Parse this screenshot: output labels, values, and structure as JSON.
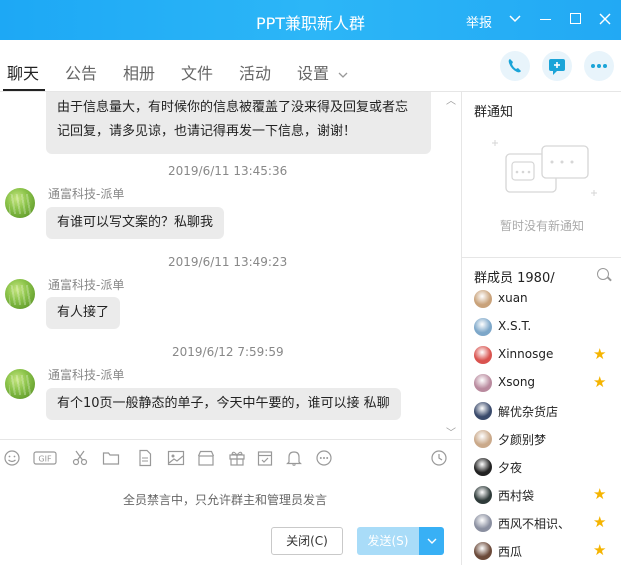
{
  "window": {
    "title": "PPT兼职新人群",
    "report_label": "举报"
  },
  "tabs": [
    {
      "label": "聊天",
      "active": true
    },
    {
      "label": "公告"
    },
    {
      "label": "相册"
    },
    {
      "label": "文件"
    },
    {
      "label": "活动"
    },
    {
      "label": "设置"
    }
  ],
  "header_actions": [
    "phone-icon",
    "chat-add-icon",
    "more-icon"
  ],
  "messages": [
    {
      "text_line1": "由于信息量大，有时候你的信息被覆盖了没来得及回复或者忘",
      "text_line2": "记回复，请多见谅，也请记得再发一下信息，谢谢！"
    },
    {
      "timestamp": "2019/6/11 13:45:36",
      "sender": "通富科技-派单",
      "text": "有谁可以写文案的？私聊我"
    },
    {
      "timestamp": "2019/6/11 13:49:23",
      "sender": "通富科技-派单",
      "text": "有人接了"
    },
    {
      "timestamp": "2019/6/12 7:59:59",
      "sender": "通富科技-派单",
      "text": "有个10页一般静态的单子，今天中午要的，谁可以接  私聊"
    }
  ],
  "toolbar_icons": [
    "emoji-icon",
    "gif-icon",
    "scissors-icon",
    "folder-icon",
    "file-icon",
    "image-icon",
    "shop-icon",
    "gift-icon",
    "calendar-icon",
    "bell-icon",
    "more-dots-icon",
    "history-clock-icon"
  ],
  "composer": {
    "muted_notice": "全员禁言中，只允许群主和管理员发言",
    "close_label": "关闭(C)",
    "send_label": "发送(S)"
  },
  "notice_panel": {
    "title": "群通知",
    "empty_text": "暂时没有新通知"
  },
  "members_panel": {
    "title": "群成员 1980/",
    "members": [
      {
        "name": "xuan",
        "star": false,
        "color": "#c9a27a"
      },
      {
        "name": "X.S.T.",
        "star": false,
        "color": "#7da7c9"
      },
      {
        "name": "Xinnosge",
        "star": true,
        "color": "#d9534f"
      },
      {
        "name": "Xsong",
        "star": true,
        "color": "#b98a9e"
      },
      {
        "name": "解优杂货店",
        "star": false,
        "color": "#3a4a6b"
      },
      {
        "name": "夕颜别梦",
        "star": false,
        "color": "#caa98a"
      },
      {
        "name": "夕夜",
        "star": false,
        "color": "#222222"
      },
      {
        "name": "西村袋",
        "star": true,
        "color": "#2f3b3a"
      },
      {
        "name": "西风不相识、",
        "star": true,
        "color": "#8a8fa0"
      },
      {
        "name": "西瓜",
        "star": true,
        "color": "#6b4a3a"
      }
    ]
  },
  "colors": {
    "titlebar": "#1da8f5",
    "accent": "#38b0f5",
    "star": "#f5b400",
    "bubble": "#ebebeb"
  }
}
